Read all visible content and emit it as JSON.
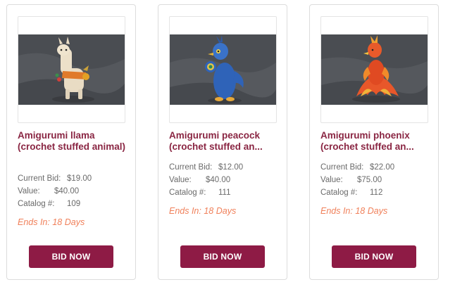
{
  "items": [
    {
      "title": "Amigurumi llama (crochet stuffed animal)",
      "current_bid_label": "Current Bid:",
      "current_bid": "$19.00",
      "value_label": "Value:",
      "value": "$40.00",
      "catalog_label": "Catalog #:",
      "catalog": "109",
      "ends": "Ends In: 18 Days",
      "button": "BID NOW"
    },
    {
      "title": "Amigurumi peacock (crochet stuffed an...",
      "current_bid_label": "Current Bid:",
      "current_bid": "$12.00",
      "value_label": "Value:",
      "value": "$40.00",
      "catalog_label": "Catalog #:",
      "catalog": "111",
      "ends": "Ends In: 18 Days",
      "button": "BID NOW"
    },
    {
      "title": "Amigurumi phoenix (crochet stuffed an...",
      "current_bid_label": "Current Bid:",
      "current_bid": "$22.00",
      "value_label": "Value:",
      "value": "$75.00",
      "catalog_label": "Catalog #:",
      "catalog": "112",
      "ends": "Ends In: 18 Days",
      "button": "BID NOW"
    }
  ],
  "colors": {
    "title": "#8a2643",
    "button": "#8e1b45",
    "ends": "#f0805a"
  }
}
